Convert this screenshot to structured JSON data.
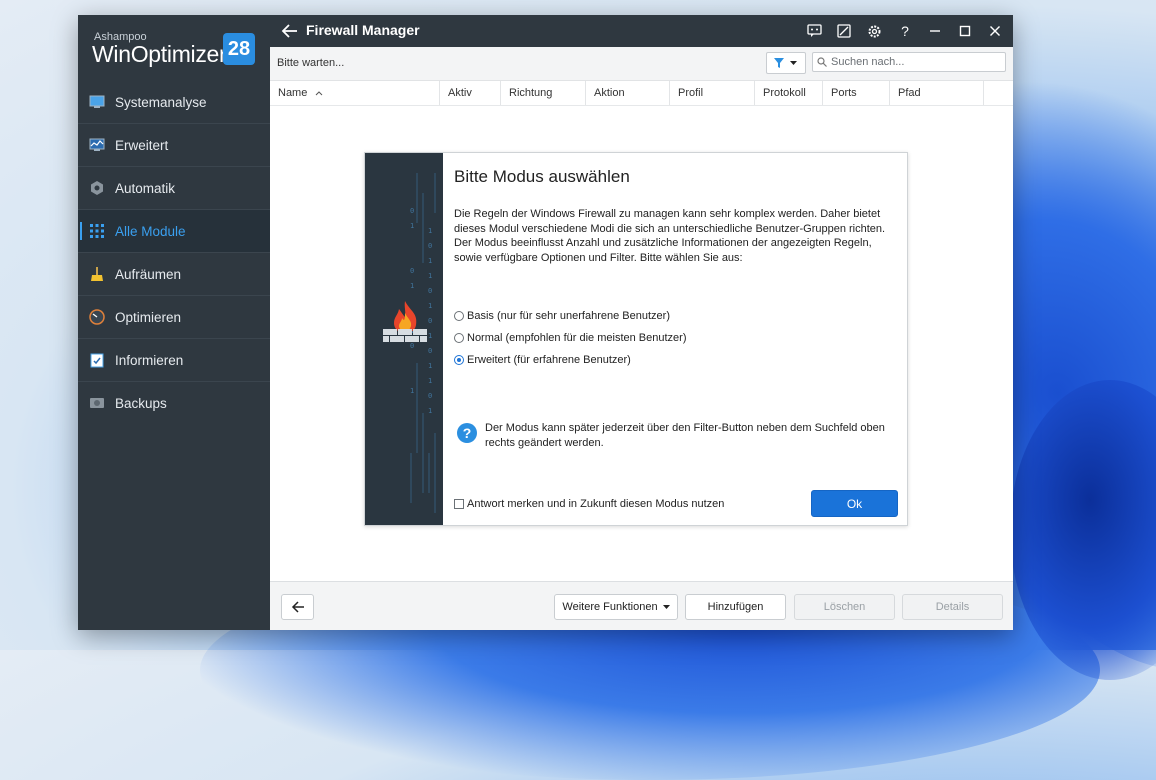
{
  "app": {
    "brand_small": "Ashampoo",
    "brand_name": "WinOptimizer",
    "brand_version": "28"
  },
  "sidebar": {
    "items": [
      {
        "label": "Systemanalyse",
        "icon": "monitor-icon"
      },
      {
        "label": "Erweitert",
        "icon": "chart-monitor-icon"
      },
      {
        "label": "Automatik",
        "icon": "gear-cube-icon"
      },
      {
        "label": "Alle Module",
        "icon": "grid-icon",
        "active": true
      },
      {
        "label": "Aufräumen",
        "icon": "broom-icon"
      },
      {
        "label": "Optimieren",
        "icon": "speedometer-icon"
      },
      {
        "label": "Informieren",
        "icon": "clipboard-check-icon"
      },
      {
        "label": "Backups",
        "icon": "hard-drive-icon"
      }
    ]
  },
  "titlebar": {
    "title": "Firewall Manager",
    "buttons": [
      "feedback-icon",
      "skin-icon",
      "settings-icon",
      "help-icon",
      "minimize-icon",
      "maximize-icon",
      "close-icon"
    ]
  },
  "toolbar": {
    "status": "Bitte warten...",
    "search_placeholder": "Suchen nach..."
  },
  "table": {
    "columns": [
      "Name",
      "Aktiv",
      "Richtung",
      "Aktion",
      "Profil",
      "Protokoll",
      "Ports",
      "Pfad"
    ],
    "sort_column": "Name",
    "sort_direction": "ascending"
  },
  "dialog": {
    "title": "Bitte Modus auswählen",
    "description": "Die Regeln der Windows Firewall zu managen kann sehr komplex werden. Daher bietet dieses Modul verschiedene Modi die sich an unterschiedliche Benutzer-Gruppen richten. Der Modus beeinflusst Anzahl und zusätzliche Informationen der angezeigten Regeln, sowie verfügbare Optionen und Filter. Bitte wählen Sie aus:",
    "options": [
      {
        "label": "Basis (nur für sehr unerfahrene Benutzer)",
        "selected": false
      },
      {
        "label": "Normal (empfohlen für die meisten Benutzer)",
        "selected": false
      },
      {
        "label": "Erweitert (für erfahrene Benutzer)",
        "selected": true
      }
    ],
    "info": "Der Modus kann später jederzeit über den Filter-Button neben dem Suchfeld oben rechts geändert werden.",
    "remember_label": "Antwort merken und in Zukunft diesen Modus nutzen",
    "remember_checked": false,
    "ok_label": "Ok"
  },
  "bottombar": {
    "more_label": "Weitere Funktionen",
    "add_label": "Hinzufügen",
    "delete_label": "Löschen",
    "details_label": "Details"
  },
  "colors": {
    "sidebar_bg": "#2f3840",
    "accent": "#3aa0f0",
    "primary_button": "#1a73d9",
    "version_badge": "#2a8de0"
  }
}
